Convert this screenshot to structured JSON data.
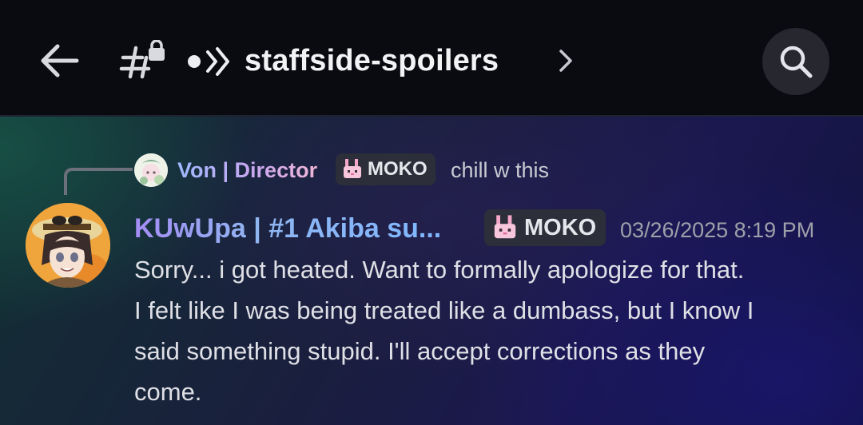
{
  "header": {
    "channel_name": "staffside-spoilers"
  },
  "reply": {
    "author": "Von | Director",
    "tag": "MOKO",
    "text": "chill w this"
  },
  "message": {
    "author": "KUwUpa | #1 Akiba su...",
    "tag": "MOKO",
    "timestamp": "03/26/2025 8:19 PM",
    "text": "Sorry... i got heated. Want to formally apologize for that.\nI felt like I was being treated like a dumbass, but I know I\nsaid something stupid. I'll accept corrections as they\ncome."
  },
  "icons": {
    "back": "arrow-left-icon",
    "channel": "locked-text-channel-icon",
    "voice": "voice-activity-icon",
    "chevron": "chevron-right-icon",
    "search": "search-icon",
    "tag_emoji": "pink-bunny-icon"
  },
  "colors": {
    "header_bg": "#0a0b10",
    "tag_bg": "#2c2e3a",
    "timestamp": "#9ea0aa",
    "message_text": "#dfe0e6"
  }
}
